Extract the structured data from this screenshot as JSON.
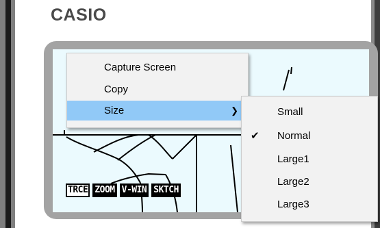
{
  "brand": "CASIO",
  "softkeys": [
    {
      "label": "TRCE",
      "outlined": true
    },
    {
      "label": "ZOOM",
      "outlined": false
    },
    {
      "label": "V-WIN",
      "outlined": false
    },
    {
      "label": "SKTCH",
      "outlined": false
    }
  ],
  "context_menu": {
    "items": [
      "Capture Screen",
      "Copy",
      "Size"
    ],
    "highlighted": "Size",
    "submenu_arrow_icon": "chevron-right-icon"
  },
  "size_submenu": {
    "items": [
      "Small",
      "Normal",
      "Large1",
      "Large2",
      "Large3"
    ],
    "checked": "Normal",
    "check_icon": "checkmark-icon"
  },
  "colors": {
    "highlight": "#91c9f7",
    "lcd_background": "#ebfafe",
    "menu_background": "#f2f2f2"
  }
}
